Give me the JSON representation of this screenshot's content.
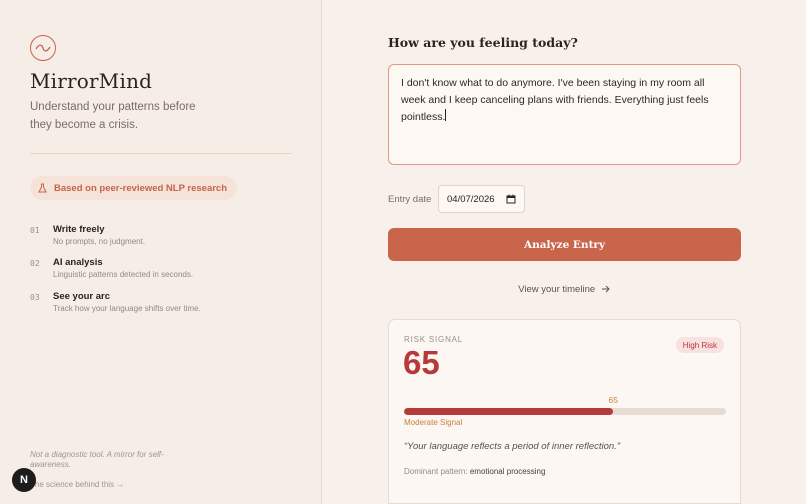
{
  "sidebar": {
    "brand": "MirrorMind",
    "tagline": "Understand your patterns before they become a crisis.",
    "research_badge": "Based on peer-reviewed NLP research",
    "steps": [
      {
        "num": "01",
        "title": "Write freely",
        "desc": "No prompts, no judgment."
      },
      {
        "num": "02",
        "title": "AI analysis",
        "desc": "Linguistic patterns detected in seconds."
      },
      {
        "num": "03",
        "title": "See your arc",
        "desc": "Track how your language shifts over time."
      }
    ],
    "disclaimer": "Not a diagnostic tool. A mirror for self-awareness.",
    "science_link": "The science behind this →",
    "dev_badge": "N"
  },
  "main": {
    "question": "How are you feeling today?",
    "entry_text": "I don't know what to do anymore. I've been staying in my room all week and I keep canceling plans with friends. Everything just feels pointless.",
    "date_label": "Entry date",
    "date_value": "04/07/2026",
    "analyze_button": "Analyze Entry",
    "timeline_link": "View your timeline",
    "result": {
      "label": "RISK SIGNAL",
      "score": "65",
      "badge": "High Risk",
      "bar_value": "65",
      "bar_fraction": 0.65,
      "level": "Moderate Signal",
      "quote": "“Your language reflects a period of inner reflection.”",
      "pattern_label": "Dominant pattern:",
      "pattern_value": "emotional processing"
    }
  },
  "colors": {
    "accent": "#c8654a",
    "risk": "#b63a3a",
    "moderate": "#c8803f"
  },
  "icons": {
    "logo": "wave-circle-icon",
    "research": "flask-icon",
    "calendar": "calendar-icon",
    "arrow": "arrow-right-icon"
  }
}
